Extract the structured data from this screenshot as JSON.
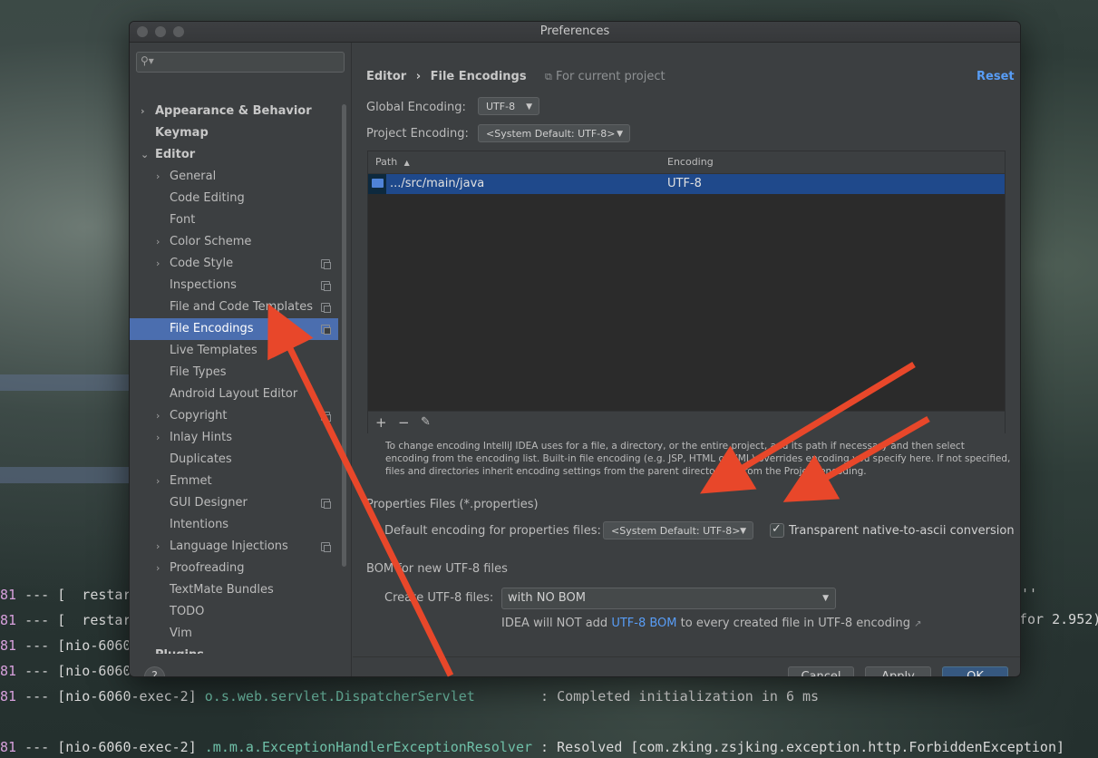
{
  "window": {
    "title": "Preferences"
  },
  "search": {
    "placeholder": ""
  },
  "sidebar": {
    "items": [
      {
        "label": "Appearance & Behavior"
      },
      {
        "label": "Keymap"
      },
      {
        "label": "Editor"
      },
      {
        "label": "General"
      },
      {
        "label": "Code Editing"
      },
      {
        "label": "Font"
      },
      {
        "label": "Color Scheme"
      },
      {
        "label": "Code Style"
      },
      {
        "label": "Inspections"
      },
      {
        "label": "File and Code Templates"
      },
      {
        "label": "File Encodings"
      },
      {
        "label": "Live Templates"
      },
      {
        "label": "File Types"
      },
      {
        "label": "Android Layout Editor"
      },
      {
        "label": "Copyright"
      },
      {
        "label": "Inlay Hints"
      },
      {
        "label": "Duplicates"
      },
      {
        "label": "Emmet"
      },
      {
        "label": "GUI Designer"
      },
      {
        "label": "Intentions"
      },
      {
        "label": "Language Injections"
      },
      {
        "label": "Proofreading"
      },
      {
        "label": "TextMate Bundles"
      },
      {
        "label": "TODO"
      },
      {
        "label": "Vim"
      },
      {
        "label": "Plugins"
      }
    ],
    "help_label": "?"
  },
  "breadcrumb": {
    "parent": "Editor",
    "separator": "›",
    "current": "File Encodings",
    "scope": "For current project",
    "reset": "Reset"
  },
  "global_encoding": {
    "label": "Global Encoding:",
    "value": "UTF-8"
  },
  "project_encoding": {
    "label": "Project Encoding:",
    "value": "<System Default: UTF-8>"
  },
  "table": {
    "columns": [
      "Path",
      "Encoding"
    ],
    "sort_indicator": "▲",
    "rows": [
      {
        "path": ".../src/main/java",
        "encoding": "UTF-8"
      }
    ],
    "toolbar": {
      "add": "+",
      "remove": "−",
      "edit": "✎"
    }
  },
  "help_text": "To change encoding IntelliJ IDEA uses for a file, a directory, or the entire project, add its path if necessary and then select encoding from the encoding list. Built-in file encoding (e.g. JSP, HTML or XML) overrides encoding you specify here. If not specified, files and directories inherit encoding settings from the parent directory or from the Project encoding.",
  "properties": {
    "section": "Properties Files (*.properties)",
    "default_label": "Default encoding for properties files:",
    "default_value": "<System Default: UTF-8>",
    "native_label": "Transparent native-to-ascii conversion",
    "native_checked": true
  },
  "bom": {
    "section": "BOM for new UTF-8 files",
    "create_label": "Create UTF-8 files:",
    "create_value": "with NO BOM",
    "note_prefix": "IDEA will NOT add",
    "note_link": "UTF-8 BOM",
    "note_suffix": "to every created file in UTF-8 encoding",
    "note_arrow": "↗"
  },
  "buttons": {
    "cancel": "Cancel",
    "apply": "Apply",
    "ok": "OK"
  },
  "terminal": {
    "lines": [
      {
        "num": "81",
        "text": " --- [  restar"
      },
      {
        "num": "81",
        "text": " --- [  restar"
      },
      {
        "num": "81",
        "text": " --- [nio-6060"
      },
      {
        "num": "81",
        "text": " --- [nio-6060"
      },
      {
        "num": "81",
        "text": " --- [nio-6060-exec-2] ",
        "cls": "o.s.web.servlet.DispatcherServlet",
        "tail": "        : Completed initialization in 6 ms"
      },
      {
        "num": "81",
        "text": " --- [nio-6060-exec-2] ",
        "cls": ".m.m.a.ExceptionHandlerExceptionResolver",
        "tail": " : Resolved [com.zking.zsjking.exception.http.ForbiddenException]"
      }
    ],
    "right_quote": "''",
    "right_tail": "for 2.952)"
  },
  "colors": {
    "accent": "#4b6eaf",
    "link": "#589df6",
    "annotation": "#e8472a"
  }
}
